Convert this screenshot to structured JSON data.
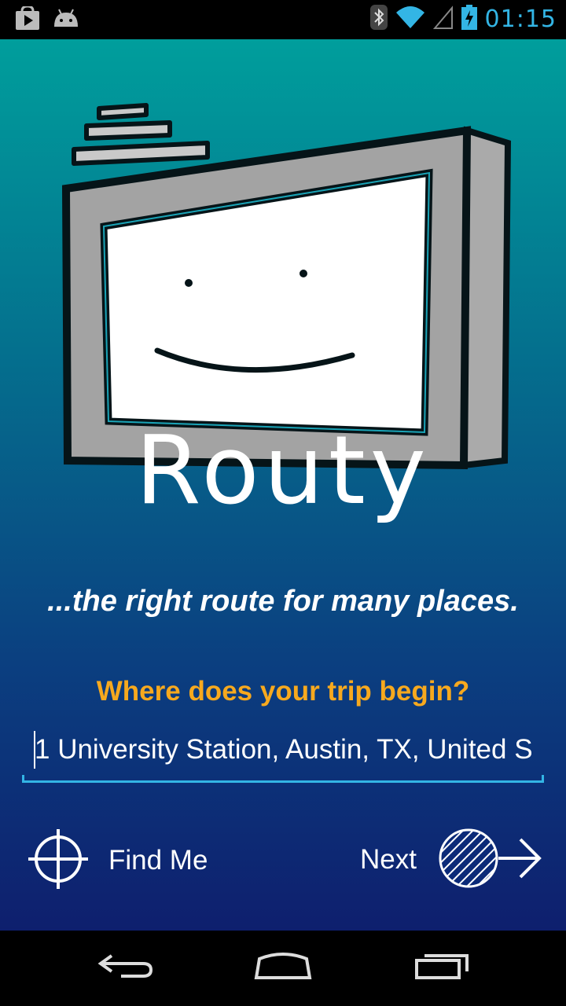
{
  "status_bar": {
    "time": "01:15",
    "icons": [
      "play-store-icon",
      "android-icon",
      "bluetooth-icon",
      "wifi-icon",
      "signal-icon",
      "battery-charging-icon"
    ]
  },
  "app": {
    "name": "Routy",
    "tagline": "...the right route for many places.",
    "prompt": "Where does your trip begin?",
    "start_address": "1 University Station, Austin, TX, United S",
    "find_me_label": "Find Me",
    "next_label": "Next"
  },
  "nav_bar": {
    "icons": [
      "back-icon",
      "home-icon",
      "recent-apps-icon"
    ]
  },
  "colors": {
    "accent": "#33b5e5",
    "prompt": "#f7a91e",
    "gradient_top": "#009e9c",
    "gradient_bottom": "#0e1f6e"
  }
}
